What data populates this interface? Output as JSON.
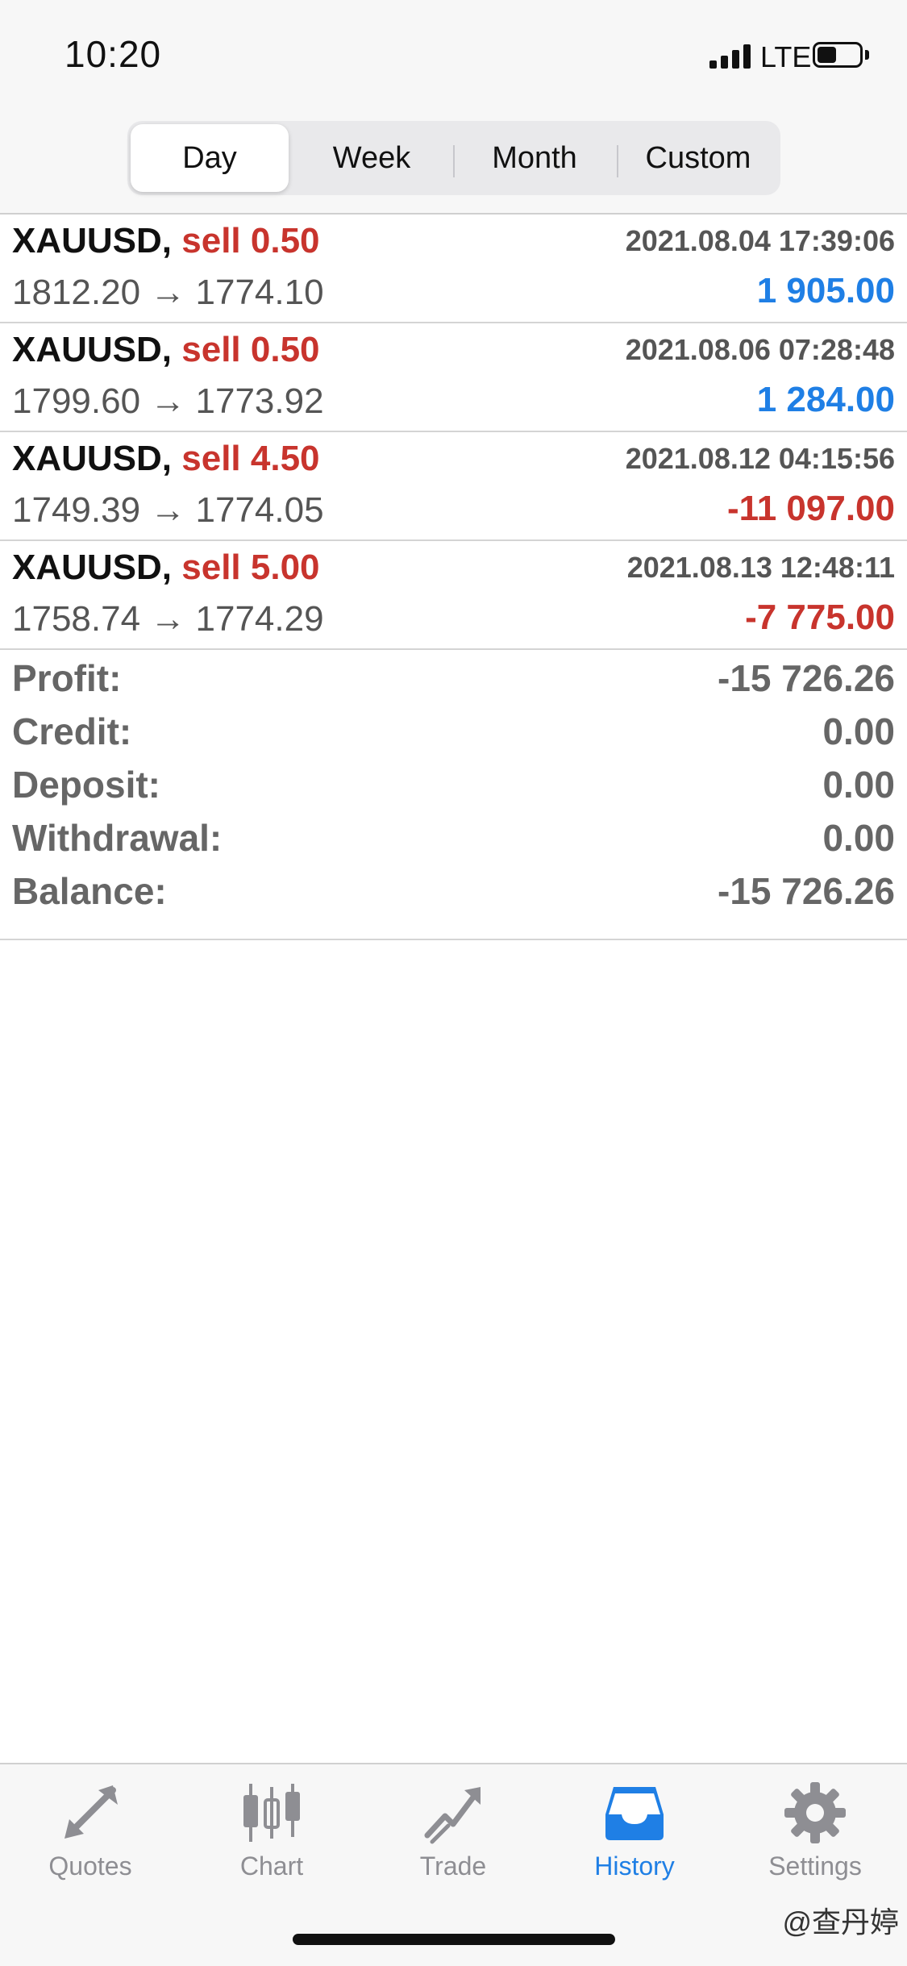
{
  "status_bar": {
    "time": "10:20",
    "network": "LTE",
    "battery_level": 0.45
  },
  "period_tabs": [
    {
      "label": "Day",
      "active": true
    },
    {
      "label": "Week",
      "active": false
    },
    {
      "label": "Month",
      "active": false
    },
    {
      "label": "Custom",
      "active": false
    }
  ],
  "deals": [
    {
      "symbol": "XAUUSD,",
      "side": "sell 0.50",
      "time": "2021.08.04 17:39:06",
      "prices": "1812.20 → 1774.10",
      "profit": "1 905.00",
      "positive": true
    },
    {
      "symbol": "XAUUSD,",
      "side": "sell 0.50",
      "time": "2021.08.06 07:28:48",
      "prices": "1799.60 → 1773.92",
      "profit": "1 284.00",
      "positive": true
    },
    {
      "symbol": "XAUUSD,",
      "side": "sell 4.50",
      "time": "2021.08.12 04:15:56",
      "prices": "1749.39 → 1774.05",
      "profit": "-11 097.00",
      "positive": false
    },
    {
      "symbol": "XAUUSD,",
      "side": "sell 5.00",
      "time": "2021.08.13 12:48:11",
      "prices": "1758.74 → 1774.29",
      "profit": "-7 775.00",
      "positive": false
    }
  ],
  "summary": {
    "profit_label": "Profit:",
    "profit_value": "-15 726.26",
    "credit_label": "Credit:",
    "credit_value": "0.00",
    "deposit_label": "Deposit:",
    "deposit_value": "0.00",
    "withdrawal_label": "Withdrawal:",
    "withdrawal_value": "0.00",
    "balance_label": "Balance:",
    "balance_value": "-15 726.26"
  },
  "tab_bar": [
    {
      "label": "Quotes",
      "icon": "quotes-arrows-icon",
      "active": false
    },
    {
      "label": "Chart",
      "icon": "candlestick-chart-icon",
      "active": false
    },
    {
      "label": "Trade",
      "icon": "trade-trend-icon",
      "active": false
    },
    {
      "label": "History",
      "icon": "inbox-tray-icon",
      "active": true
    },
    {
      "label": "Settings",
      "icon": "gear-icon",
      "active": false
    }
  ],
  "watermark": "@查丹婷",
  "colors": {
    "accent": "#1f7fe5",
    "sell": "#c8342d",
    "profit_positive": "#1f7fe5",
    "profit_negative": "#c8342d",
    "muted": "#8e8e93"
  }
}
